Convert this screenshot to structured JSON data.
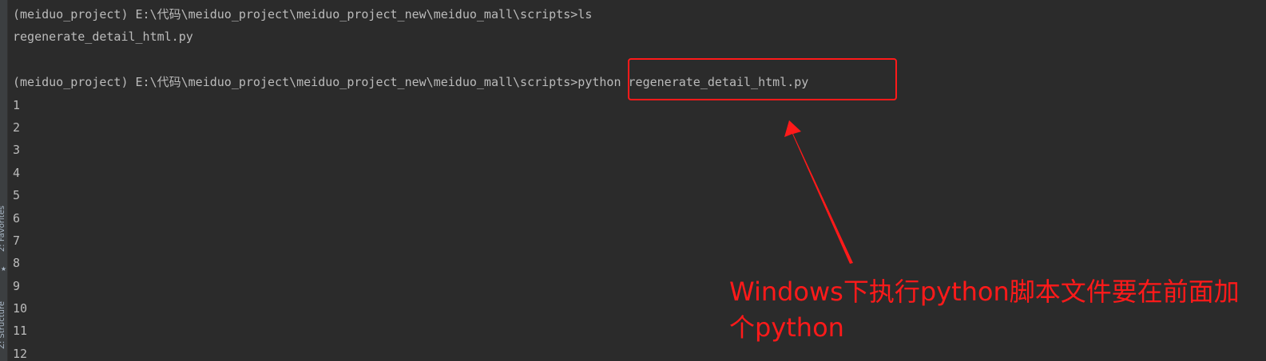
{
  "terminal": {
    "lines": [
      "(meiduo_project) E:\\代码\\meiduo_project\\meiduo_project_new\\meiduo_mall\\scripts>ls",
      "regenerate_detail_html.py",
      "",
      "(meiduo_project) E:\\代码\\meiduo_project\\meiduo_project_new\\meiduo_mall\\scripts>python regenerate_detail_html.py",
      "1",
      "2",
      "3",
      "4",
      "5",
      "6",
      "7",
      "8",
      "9",
      "10",
      "11",
      "12"
    ]
  },
  "side_tabs": {
    "favorites": "2: Favorites",
    "structure": "Z: Structure",
    "star_icon": "★"
  },
  "annotation": {
    "text": "Windows下执行python脚本文件要在前面加个python",
    "color": "#ff1a1a",
    "highlight_icon": "red-rectangle",
    "arrow_icon": "red-arrow"
  },
  "colors": {
    "background": "#2b2b2b",
    "terminal_text": "#bbbbbb",
    "accent_red": "#ff1a1a"
  }
}
